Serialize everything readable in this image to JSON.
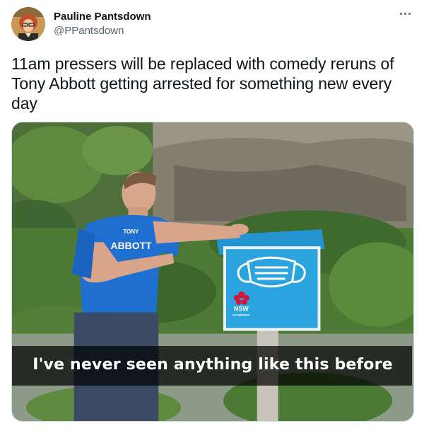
{
  "user": {
    "display_name": "Pauline Pantsdown",
    "handle": "@PPantsdown"
  },
  "tweet": {
    "text": "11am pressers will be replaced with comedy reruns of Tony Abbott getting arrested for something new every day"
  },
  "media": {
    "caption": "I've never seen anything like this before",
    "shirt_text_top": "TONY",
    "shirt_text_main": "ABBOTT",
    "sign_logo_text": "NSW",
    "sign_logo_sub": "GOVERNMENT",
    "colors": {
      "shirt": "#1f6fd1",
      "sign": "#2aa3de",
      "caption_bg": "#000000"
    }
  },
  "icons": {
    "more": "more-horizontal-icon",
    "sign_symbol": "face-mask-icon",
    "logo": "waratah-flower-icon"
  }
}
